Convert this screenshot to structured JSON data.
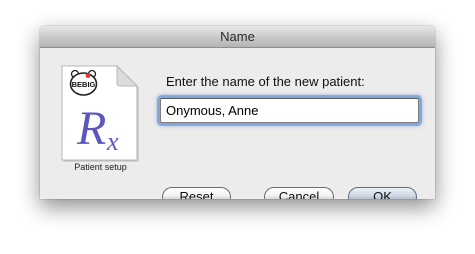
{
  "window": {
    "title": "Name"
  },
  "icon": {
    "badge_text": "BEBIG",
    "symbol": "Rx",
    "caption": "Patient setup"
  },
  "dialog": {
    "prompt": "Enter the name of the new patient:",
    "name_value": "Onymous, Anne",
    "focus_color": "#7aa2d8"
  },
  "buttons": {
    "reset_label": "Reset",
    "cancel_label": "Cancel",
    "ok_label": "OK"
  }
}
